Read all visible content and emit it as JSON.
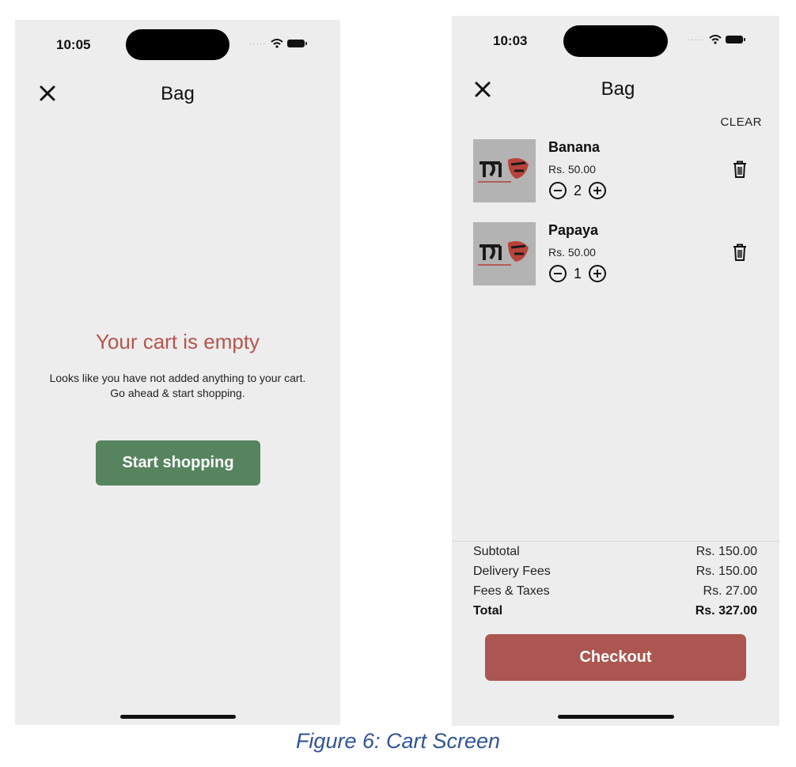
{
  "empty_screen": {
    "status_time": "10:05",
    "title": "Bag",
    "empty_title": "Your cart is empty",
    "empty_line1": "Looks like you have not added anything to your cart.",
    "empty_line2": "Go ahead & start shopping.",
    "start_button": "Start shopping"
  },
  "cart_screen": {
    "status_time": "10:03",
    "title": "Bag",
    "clear_label": "CLEAR",
    "items": [
      {
        "name": "Banana",
        "price": "Rs. 50.00",
        "qty": "2"
      },
      {
        "name": "Papaya",
        "price": "Rs. 50.00",
        "qty": "1"
      }
    ],
    "summary": {
      "subtotal_label": "Subtotal",
      "subtotal_value": "Rs. 150.00",
      "delivery_label": "Delivery Fees",
      "delivery_value": "Rs. 150.00",
      "fees_label": "Fees & Taxes",
      "fees_value": "Rs. 27.00",
      "total_label": "Total",
      "total_value": "Rs. 327.00"
    },
    "checkout_button": "Checkout"
  },
  "caption": "Figure 6: Cart Screen",
  "colors": {
    "empty_title": "#b5554e",
    "start_button": "#56845f",
    "checkout_button": "#ab5650",
    "caption": "#2f5496"
  },
  "icons": [
    "close-icon",
    "wifi-icon",
    "battery-icon",
    "minus-circle-icon",
    "plus-circle-icon",
    "trash-icon",
    "product-logo"
  ]
}
